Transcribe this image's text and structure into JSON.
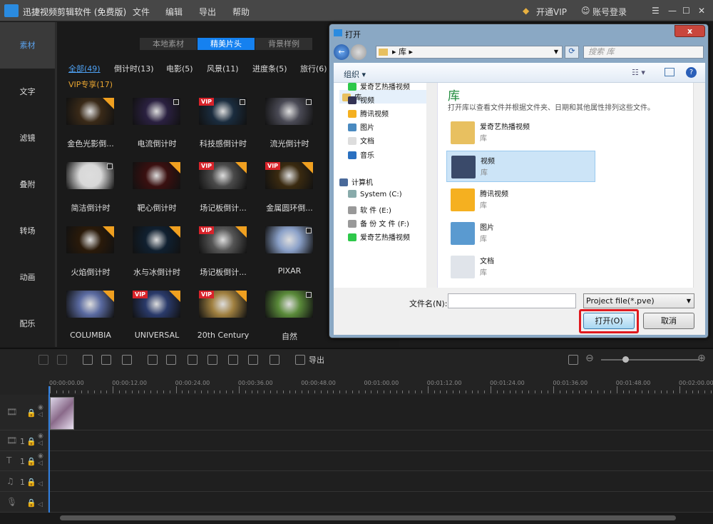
{
  "app": {
    "title": "迅捷视频剪辑软件 (免费版)",
    "menus": [
      "文件",
      "编辑",
      "导出",
      "帮助"
    ],
    "vip": "开通VIP",
    "login": "账号登录",
    "accent": "#1581f0"
  },
  "sidebar": {
    "items": [
      "素材",
      "文字",
      "滤镜",
      "叠附",
      "转场",
      "动画",
      "配乐"
    ],
    "active": 0
  },
  "content": {
    "tabs": [
      "本地素材",
      "精美片头",
      "背景样例"
    ],
    "active_tab": 1,
    "categories": [
      "全部(49)",
      "倒计时(13)",
      "电影(5)",
      "风景(11)",
      "进度条(5)",
      "旅行(6)"
    ],
    "vip_category": "VIP专享(17)",
    "items": [
      {
        "label": "金色光影倒...",
        "badge": "download",
        "color": "#3a2a18"
      },
      {
        "label": "电流倒计时",
        "badge": "add",
        "color": "#2a2040"
      },
      {
        "label": "科技感倒计时",
        "badge": "vip-add",
        "color": "#1a2c3e"
      },
      {
        "label": "流光倒计时",
        "badge": "add",
        "color": "#4a4a55"
      },
      {
        "label": "简洁倒计时",
        "badge": "add",
        "color": "#d8d8d8"
      },
      {
        "label": "靶心倒计时",
        "badge": "download",
        "color": "#3a1010"
      },
      {
        "label": "场记板倒计...",
        "badge": "vip-download",
        "color": "#4a4a4a"
      },
      {
        "label": "金属圆环倒...",
        "badge": "vip-download",
        "color": "#3a2a10"
      },
      {
        "label": "火焰倒计时",
        "badge": "download",
        "color": "#2a1a0a"
      },
      {
        "label": "水与冰倒计时",
        "badge": "download",
        "color": "#102030"
      },
      {
        "label": "场记板倒计...",
        "badge": "vip-download",
        "color": "#555"
      },
      {
        "label": "PIXAR",
        "badge": "add",
        "color": "#8aa0c8"
      },
      {
        "label": "COLUMBIA",
        "badge": "download",
        "color": "#5a6aa0"
      },
      {
        "label": "UNIVERSAL",
        "badge": "vip-download",
        "color": "#2a3a6a"
      },
      {
        "label": "20th Century",
        "badge": "vip-download",
        "color": "#a08040"
      },
      {
        "label": "自然",
        "badge": "add",
        "color": "#5a8a3a"
      }
    ]
  },
  "dialog": {
    "title": "打开",
    "close": "x",
    "breadcrumb": "库",
    "search_placeholder": "搜索 库",
    "organize": "组织 ▾",
    "nav": [
      {
        "label": "库",
        "color": "#e8c060"
      },
      {
        "label": "爱奇艺热播视频",
        "color": "#2ec84a"
      },
      {
        "label": "视频",
        "color": "#335"
      },
      {
        "label": "腾讯视频",
        "color": "#f5b020"
      },
      {
        "label": "图片",
        "color": "#4a8ac0"
      },
      {
        "label": "文档",
        "color": "#ddd"
      },
      {
        "label": "音乐",
        "color": "#2a70c0"
      },
      {
        "label": "计算机",
        "color": "#4a6a9a"
      },
      {
        "label": "System (C:)",
        "color": "#8aa"
      },
      {
        "label": "软 件 (E:)",
        "color": "#999"
      },
      {
        "label": "备 份 文 件 (F:)",
        "color": "#999"
      },
      {
        "label": "爱奇艺热播视频",
        "color": "#2ec84a"
      }
    ],
    "heading": "库",
    "description": "打开库以查看文件并根据文件夹、日期和其他属性排列这些文件。",
    "libraries": [
      {
        "name": "爱奇艺热播视频",
        "sub": "库",
        "color": "#e8c060"
      },
      {
        "name": "视频",
        "sub": "库",
        "color": "#3a4a6a"
      },
      {
        "name": "腾讯视频",
        "sub": "库",
        "color": "#f5b020"
      },
      {
        "name": "图片",
        "sub": "库",
        "color": "#5a9ad0"
      },
      {
        "name": "文档",
        "sub": "库",
        "color": "#e0e4ea"
      }
    ],
    "selected_library": 1,
    "filename_label": "文件名(N):",
    "filename_value": "",
    "filetype": "Project file(*.pve)",
    "open": "打开(O)",
    "cancel": "取消"
  },
  "timeline": {
    "export": "导出",
    "ticks": [
      "00:00:00.00",
      "00:00:12.00",
      "00:00:24.00",
      "00:00:36.00",
      "00:00:48.00",
      "00:01:00.00",
      "00:01:12.00",
      "00:01:24.00",
      "00:01:36.00",
      "00:01:48.00",
      "00:02:00.00"
    ],
    "track_counts": [
      "1",
      "1",
      "1"
    ]
  }
}
